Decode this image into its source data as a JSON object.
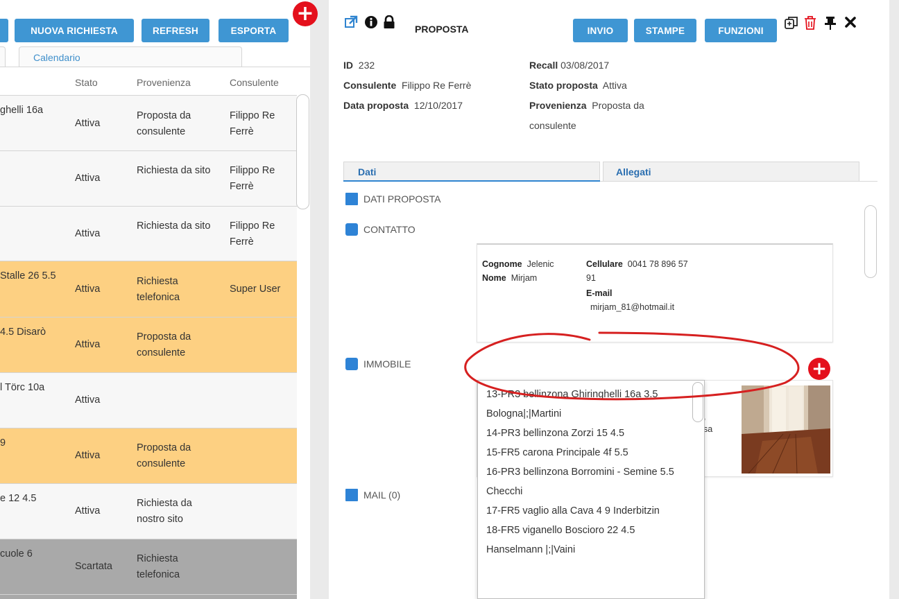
{
  "left": {
    "buttons": {
      "nuova": "NUOVA RICHIESTA",
      "refresh": "REFRESH",
      "esporta": "ESPORTA"
    },
    "tabs": {
      "calendario": "Calendario"
    },
    "columns": {
      "stato": "Stato",
      "provenienza": "Provenienza",
      "consulente": "Consulente"
    },
    "rows": [
      {
        "addr": "ghelli 16a",
        "stato": "Attiva",
        "prov": "Proposta da consulente",
        "cons": "Filippo Re Ferrè",
        "color": "white"
      },
      {
        "addr": "",
        "stato": "Attiva",
        "prov": "Richiesta da sito",
        "cons": "Filippo Re Ferrè",
        "color": "white"
      },
      {
        "addr": "",
        "stato": "Attiva",
        "prov": "Richiesta da sito",
        "cons": "Filippo Re Ferrè",
        "color": "white"
      },
      {
        "addr": "Stalle 26 5.5",
        "stato": "Attiva",
        "prov": "Richiesta telefonica",
        "cons": "Super User",
        "color": "orange"
      },
      {
        "addr": "4.5 Disarò",
        "stato": "Attiva",
        "prov": "Proposta da consulente",
        "cons": "",
        "color": "orange"
      },
      {
        "addr": "l Törc 10a",
        "stato": "Attiva",
        "prov": "",
        "cons": "",
        "color": "white"
      },
      {
        "addr": "9",
        "stato": "Attiva",
        "prov": "Proposta da consulente",
        "cons": "",
        "color": "orange"
      },
      {
        "addr": "e 12 4.5",
        "stato": "Attiva",
        "prov": "Richiesta da nostro sito",
        "cons": "",
        "color": "white"
      },
      {
        "addr": "cuole 6",
        "stato": "Scartata",
        "prov": "Richiesta telefonica",
        "cons": "",
        "color": "grey"
      }
    ]
  },
  "right": {
    "title": "PROPOSTA",
    "buttons": {
      "invio": "INVIO",
      "stampe": "STAMPE",
      "funzioni": "FUNZIONI"
    },
    "meta": {
      "id_label": "ID",
      "id_value": "232",
      "consulente_label": "Consulente",
      "consulente_value": "Filippo Re Ferrè",
      "data_label": "Data proposta",
      "data_value": "12/10/2017",
      "recall_label": "Recall",
      "recall_value": "03/08/2017",
      "stato_label": "Stato proposta",
      "stato_value": "Attiva",
      "provenienza_label": "Provenienza",
      "provenienza_value": "Proposta da consulente"
    },
    "tabs": {
      "dati": "Dati",
      "allegati": "Allegati"
    },
    "sections": {
      "dati_proposta": "DATI PROPOSTA",
      "contatto": "CONTATTO",
      "immobile": "IMMOBILE",
      "mail": "MAIL (0)"
    },
    "contact": {
      "cognome_label": "Cognome",
      "cognome": "Jelenic",
      "nome_label": "Nome",
      "nome": "Mirjam",
      "cellulare_label": "Cellulare",
      "cellulare_1": "0041 78 896 57",
      "cellulare_2": "91",
      "email_label": "E-mail",
      "email": "mirjam_81@hotmail.it"
    },
    "partial_card_text": {
      "line1": ",",
      "line2": "sa"
    },
    "dropdown_options": [
      "13-PR3 bellinzona Ghiringhelli 16a 3.5 Bologna|;|Martini",
      "14-PR3 bellinzona Zorzi 15 4.5",
      "15-FR5 carona Principale 4f 5.5",
      "16-PR3 bellinzona Borromini - Semine 5.5 Checchi",
      "17-FR5 vaglio alla Cava 4 9 Inderbitzin",
      "18-FR5 viganello Boscioro 22 4.5 Hanselmann |;|Vaini"
    ]
  },
  "colors": {
    "button": "#3f96d3",
    "orange_row": "#fdd082",
    "grey_row": "#a9a9a9",
    "red": "#e4101c",
    "section": "#2e83d6"
  }
}
